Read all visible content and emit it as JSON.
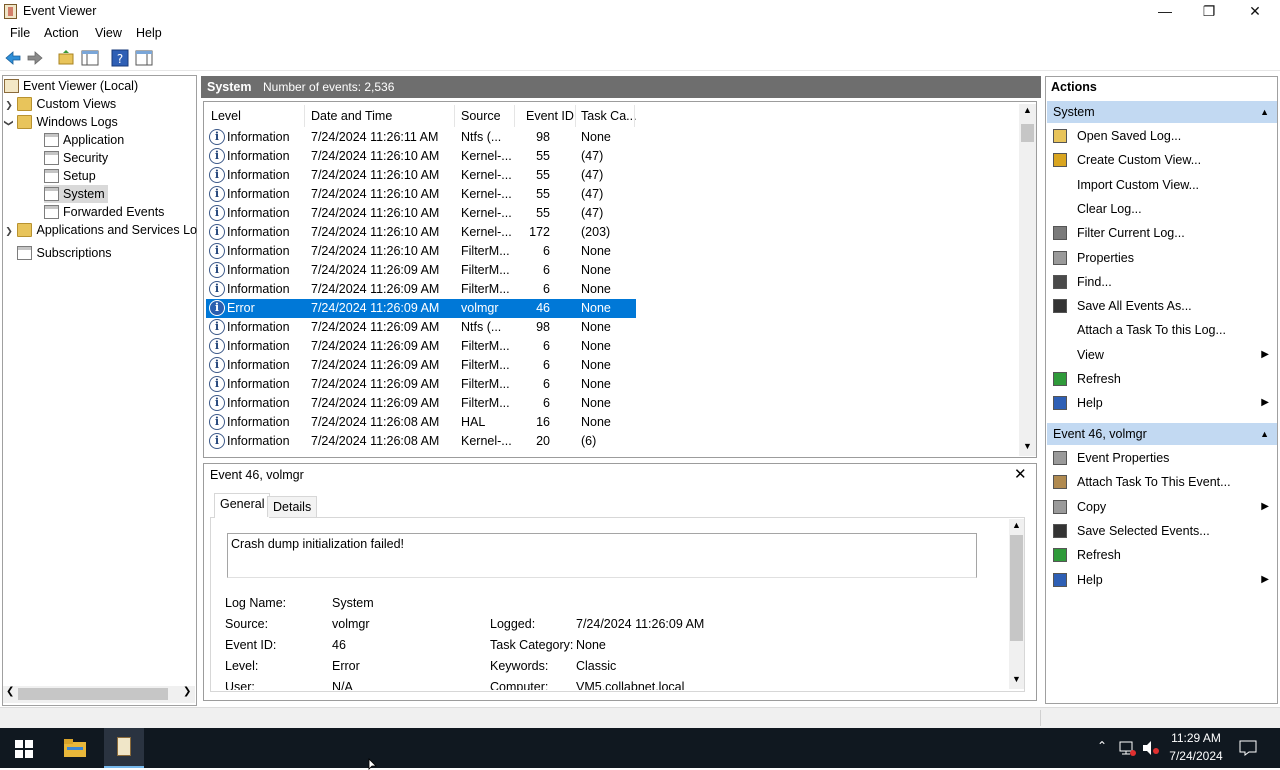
{
  "window": {
    "title": "Event Viewer",
    "minimize": "—",
    "maximize": "❐",
    "close": "✕"
  },
  "menu": [
    "File",
    "Action",
    "View",
    "Help"
  ],
  "tree": {
    "root": "Event Viewer (Local)",
    "custom_views": "Custom Views",
    "windows_logs": "Windows Logs",
    "logs": [
      "Application",
      "Security",
      "Setup",
      "System",
      "Forwarded Events"
    ],
    "app_services": "Applications and Services Lo",
    "subscriptions": "Subscriptions"
  },
  "center": {
    "log_name": "System",
    "count_label": "Number of events: 2,536",
    "columns": [
      "Level",
      "Date and Time",
      "Source",
      "Event ID",
      "Task Ca..."
    ],
    "rows": [
      {
        "level": "Information",
        "date": "7/24/2024 11:26:11 AM",
        "source": "Ntfs (...",
        "id": "98",
        "task": "None"
      },
      {
        "level": "Information",
        "date": "7/24/2024 11:26:10 AM",
        "source": "Kernel-...",
        "id": "55",
        "task": "(47)"
      },
      {
        "level": "Information",
        "date": "7/24/2024 11:26:10 AM",
        "source": "Kernel-...",
        "id": "55",
        "task": "(47)"
      },
      {
        "level": "Information",
        "date": "7/24/2024 11:26:10 AM",
        "source": "Kernel-...",
        "id": "55",
        "task": "(47)"
      },
      {
        "level": "Information",
        "date": "7/24/2024 11:26:10 AM",
        "source": "Kernel-...",
        "id": "55",
        "task": "(47)"
      },
      {
        "level": "Information",
        "date": "7/24/2024 11:26:10 AM",
        "source": "Kernel-...",
        "id": "172",
        "task": "(203)"
      },
      {
        "level": "Information",
        "date": "7/24/2024 11:26:10 AM",
        "source": "FilterM...",
        "id": "6",
        "task": "None"
      },
      {
        "level": "Information",
        "date": "7/24/2024 11:26:09 AM",
        "source": "FilterM...",
        "id": "6",
        "task": "None"
      },
      {
        "level": "Information",
        "date": "7/24/2024 11:26:09 AM",
        "source": "FilterM...",
        "id": "6",
        "task": "None"
      },
      {
        "level": "Error",
        "date": "7/24/2024 11:26:09 AM",
        "source": "volmgr",
        "id": "46",
        "task": "None"
      },
      {
        "level": "Information",
        "date": "7/24/2024 11:26:09 AM",
        "source": "Ntfs (...",
        "id": "98",
        "task": "None"
      },
      {
        "level": "Information",
        "date": "7/24/2024 11:26:09 AM",
        "source": "FilterM...",
        "id": "6",
        "task": "None"
      },
      {
        "level": "Information",
        "date": "7/24/2024 11:26:09 AM",
        "source": "FilterM...",
        "id": "6",
        "task": "None"
      },
      {
        "level": "Information",
        "date": "7/24/2024 11:26:09 AM",
        "source": "FilterM...",
        "id": "6",
        "task": "None"
      },
      {
        "level": "Information",
        "date": "7/24/2024 11:26:09 AM",
        "source": "FilterM...",
        "id": "6",
        "task": "None"
      },
      {
        "level": "Information",
        "date": "7/24/2024 11:26:08 AM",
        "source": "HAL",
        "id": "16",
        "task": "None"
      },
      {
        "level": "Information",
        "date": "7/24/2024 11:26:08 AM",
        "source": "Kernel-...",
        "id": "20",
        "task": "(6)"
      }
    ]
  },
  "detail": {
    "title": "Event 46, volmgr",
    "tabs": [
      "General",
      "Details"
    ],
    "message": "Crash dump initialization failed!",
    "labels": {
      "log_name": "Log Name:",
      "source": "Source:",
      "event_id": "Event ID:",
      "level": "Level:",
      "user": "User:",
      "logged": "Logged:",
      "task_category": "Task Category:",
      "keywords": "Keywords:",
      "computer": "Computer:"
    },
    "values": {
      "log_name": "System",
      "source": "volmgr",
      "event_id": "46",
      "level": "Error",
      "user": "N/A",
      "logged": "7/24/2024 11:26:09 AM",
      "task_category": "None",
      "keywords": "Classic",
      "computer": "VM5.collabnet.local"
    }
  },
  "actions": {
    "title": "Actions",
    "system_section": "System",
    "system_items": [
      "Open Saved Log...",
      "Create Custom View...",
      "Import Custom View...",
      "Clear Log...",
      "Filter Current Log...",
      "Properties",
      "Find...",
      "Save All Events As...",
      "Attach a Task To this Log...",
      "View",
      "Refresh",
      "Help"
    ],
    "event_section": "Event 46, volmgr",
    "event_items": [
      "Event Properties",
      "Attach Task To This Event...",
      "Copy",
      "Save Selected Events...",
      "Refresh",
      "Help"
    ]
  },
  "taskbar": {
    "time": "11:29 AM",
    "date": "7/24/2024"
  },
  "colors": {
    "selection": "#0078d7",
    "section_header": "#c2d9f2",
    "center_header": "#6e6e6e",
    "taskbar": "#101820"
  }
}
